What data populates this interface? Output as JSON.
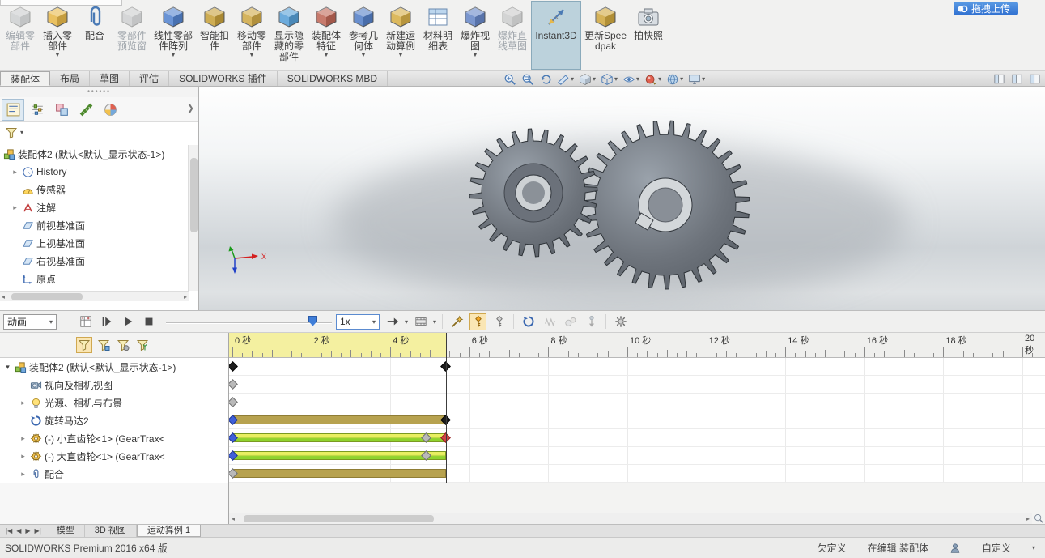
{
  "overlay": {
    "upload_label": "拖拽上传"
  },
  "ribbon": {
    "buttons": [
      {
        "label": "编辑零部件",
        "icon": "edit-component",
        "color": "#9fb6c8",
        "disabled": true,
        "dropdown": false
      },
      {
        "label": "插入零部件",
        "icon": "insert-component",
        "color": "#e8b94a",
        "disabled": false,
        "dropdown": true
      },
      {
        "label": "配合",
        "icon": "mate",
        "color": "#d8a840",
        "disabled": false,
        "dropdown": false
      },
      {
        "label": "零部件预览窗",
        "icon": "preview-window",
        "color": "#aab6c2",
        "disabled": true,
        "dropdown": false
      },
      {
        "label": "线性零部件阵列",
        "icon": "linear-pattern",
        "color": "#5585d0",
        "disabled": false,
        "dropdown": true
      },
      {
        "label": "智能扣件",
        "icon": "smart-fasteners",
        "color": "#c8a23c",
        "disabled": false,
        "dropdown": false
      },
      {
        "label": "移动零部件",
        "icon": "move-component",
        "color": "#d0aa48",
        "disabled": false,
        "dropdown": true
      },
      {
        "label": "显示隐藏的零部件",
        "icon": "show-hidden",
        "color": "#58a0d8",
        "disabled": false,
        "dropdown": false
      },
      {
        "label": "装配体特征",
        "icon": "assembly-features",
        "color": "#c06858",
        "disabled": false,
        "dropdown": true
      },
      {
        "label": "参考几何体",
        "icon": "reference-geometry",
        "color": "#5580c8",
        "disabled": false,
        "dropdown": true
      },
      {
        "label": "新建运动算例",
        "icon": "motion-study",
        "color": "#d8b048",
        "disabled": false,
        "dropdown": true
      },
      {
        "label": "材料明细表",
        "icon": "bom",
        "color": "#58a0d8",
        "disabled": false,
        "dropdown": false
      },
      {
        "label": "爆炸视图",
        "icon": "exploded-view",
        "color": "#6888c8",
        "disabled": false,
        "dropdown": true
      },
      {
        "label": "爆炸直线草图",
        "icon": "explode-line-sketch",
        "color": "#a8b0b8",
        "disabled": true,
        "dropdown": false
      },
      {
        "label": "Instant3D",
        "icon": "instant3d",
        "color": "#5580c8",
        "disabled": false,
        "dropdown": false,
        "pressed": true
      },
      {
        "label": "更新Speedpak",
        "icon": "speedpak",
        "color": "#d0a840",
        "disabled": false,
        "dropdown": false
      },
      {
        "label": "拍快照",
        "icon": "snapshot",
        "color": "#8a9098",
        "disabled": false,
        "dropdown": false
      }
    ]
  },
  "command_tabs": [
    {
      "label": "装配体",
      "active": true
    },
    {
      "label": "布局",
      "active": false
    },
    {
      "label": "草图",
      "active": false
    },
    {
      "label": "评估",
      "active": false
    },
    {
      "label": "SOLIDWORKS 插件",
      "active": false
    },
    {
      "label": "SOLIDWORKS MBD",
      "active": false
    }
  ],
  "headsup": [
    {
      "name": "zoom-fit-icon",
      "dropdown": false
    },
    {
      "name": "zoom-area-icon",
      "dropdown": false
    },
    {
      "name": "previous-view-icon",
      "dropdown": false
    },
    {
      "name": "section-view-icon",
      "dropdown": true
    },
    {
      "name": "view-orientation-icon",
      "dropdown": true
    },
    {
      "name": "display-style-icon",
      "dropdown": true
    },
    {
      "name": "hide-show-items-icon",
      "dropdown": true
    },
    {
      "name": "edit-appearance-icon",
      "dropdown": true
    },
    {
      "name": "apply-scene-icon",
      "dropdown": true
    },
    {
      "name": "view-settings-icon",
      "dropdown": true
    }
  ],
  "pane_controls": [
    "left-pane-icon",
    "split-pane-icon",
    "right-pane-icon"
  ],
  "feature_panel": {
    "tabs": [
      "featuremanager-tab",
      "propertymanager-tab",
      "configurationmanager-tab",
      "dimxpertmanager-tab",
      "displaymanager-tab"
    ],
    "items": [
      {
        "label": "装配体2 (默认<默认_显示状态-1>)",
        "icon": "assembly",
        "arrow": "none",
        "level": 0
      },
      {
        "label": "History",
        "icon": "history",
        "arrow": "right",
        "level": 1
      },
      {
        "label": "传感器",
        "icon": "sensors",
        "arrow": "none",
        "level": 1
      },
      {
        "label": "注解",
        "icon": "annotations",
        "arrow": "right",
        "level": 1
      },
      {
        "label": "前视基准面",
        "icon": "plane",
        "arrow": "none",
        "level": 1
      },
      {
        "label": "上视基准面",
        "icon": "plane",
        "arrow": "none",
        "level": 1
      },
      {
        "label": "右视基准面",
        "icon": "plane",
        "arrow": "none",
        "level": 1
      },
      {
        "label": "原点",
        "icon": "origin",
        "arrow": "none",
        "level": 1
      }
    ]
  },
  "viewport": {
    "triad_x_label": "X"
  },
  "motion": {
    "study_type_label": "动画",
    "toolbar": [
      {
        "name": "calculate-icon"
      },
      {
        "name": "play-from-start-icon"
      },
      {
        "name": "play-icon"
      },
      {
        "name": "stop-icon"
      },
      {
        "type": "slider",
        "name": "timeline-position-slider"
      },
      {
        "type": "select",
        "name": "playback-speed-select",
        "label": "1x"
      },
      {
        "name": "playback-mode-icon",
        "dropdown": true
      },
      {
        "name": "save-animation-icon",
        "dropdown": true
      },
      {
        "type": "divider"
      },
      {
        "name": "animation-wizard-icon"
      },
      {
        "name": "autokey-icon",
        "pressed": true
      },
      {
        "name": "add-key-icon"
      },
      {
        "type": "divider"
      },
      {
        "name": "motor-icon"
      },
      {
        "name": "spring-icon",
        "disabled": true
      },
      {
        "name": "contact-icon",
        "disabled": true
      },
      {
        "name": "gravity-icon",
        "disabled": true
      },
      {
        "type": "divider"
      },
      {
        "name": "study-properties-icon"
      }
    ],
    "filters": [
      {
        "name": "filter-all-icon",
        "pressed": true
      },
      {
        "name": "filter-animated-icon",
        "pressed": false
      },
      {
        "name": "filter-driving-icon",
        "pressed": false
      },
      {
        "name": "filter-selected-icon",
        "pressed": false
      }
    ],
    "tree": [
      {
        "label": "装配体2 (默认<默认_显示状态-1>)",
        "icon": "assembly",
        "arrow": "down",
        "level": 0
      },
      {
        "label": "视向及相机视图",
        "icon": "camera-views",
        "arrow": "none",
        "level": 1
      },
      {
        "label": "光源、相机与布景",
        "icon": "lights",
        "arrow": "right",
        "level": 1
      },
      {
        "label": "旋转马达2",
        "icon": "motor",
        "arrow": "none",
        "level": 1
      },
      {
        "label": "(-) 小直齿轮<1> (GearTrax<",
        "icon": "gear-part",
        "arrow": "right",
        "level": 1
      },
      {
        "label": "(-) 大直齿轮<1> (GearTrax<",
        "icon": "gear-part",
        "arrow": "right",
        "level": 1
      },
      {
        "label": "配合",
        "icon": "mates",
        "arrow": "right",
        "level": 1
      }
    ],
    "timeline": {
      "unit_suffix": "秒",
      "tick_interval_s": 2,
      "tick_labels": [
        "0 秒",
        "2 秒",
        "4 秒",
        "6 秒",
        "8 秒",
        "10 秒",
        "12 秒",
        "14 秒",
        "16 秒",
        "18 秒",
        "20 秒"
      ],
      "max_time_s": 20.5,
      "active_range_s": [
        0,
        5.4
      ],
      "playhead_s": 5.4,
      "rows": [
        {
          "keys": [
            {
              "t": 0,
              "color": "black"
            },
            {
              "t": 5.4,
              "color": "black"
            }
          ],
          "bars": []
        },
        {
          "keys": [
            {
              "t": 0,
              "color": "gray"
            }
          ],
          "bars": []
        },
        {
          "keys": [
            {
              "t": 0,
              "color": "gray"
            }
          ],
          "bars": []
        },
        {
          "keys": [
            {
              "t": 0,
              "color": "blue"
            },
            {
              "t": 5.4,
              "color": "black"
            }
          ],
          "bars": [
            {
              "t0": 0,
              "t1": 5.4,
              "style": "olive"
            }
          ]
        },
        {
          "keys": [
            {
              "t": 0,
              "color": "blue"
            },
            {
              "t": 4.9,
              "color": "gray"
            },
            {
              "t": 5.4,
              "color": "red"
            }
          ],
          "bars": [
            {
              "t0": 0,
              "t1": 5.4,
              "style": "green"
            }
          ]
        },
        {
          "keys": [
            {
              "t": 0,
              "color": "blue"
            },
            {
              "t": 4.9,
              "color": "gray"
            }
          ],
          "bars": [
            {
              "t0": 0,
              "t1": 5.4,
              "style": "green"
            }
          ]
        },
        {
          "keys": [
            {
              "t": 0,
              "color": "gray"
            }
          ],
          "bars": [
            {
              "t0": 0,
              "t1": 5.4,
              "style": "olive"
            }
          ]
        }
      ]
    }
  },
  "doc_tabs": [
    {
      "label": "模型",
      "active": false
    },
    {
      "label": "3D 视图",
      "active": false
    },
    {
      "label": "运动算例 1",
      "active": true
    }
  ],
  "statusbar": {
    "left": "SOLIDWORKS Premium 2016 x64 版",
    "right": [
      "欠定义",
      "在编辑 装配体",
      "自定义"
    ]
  }
}
